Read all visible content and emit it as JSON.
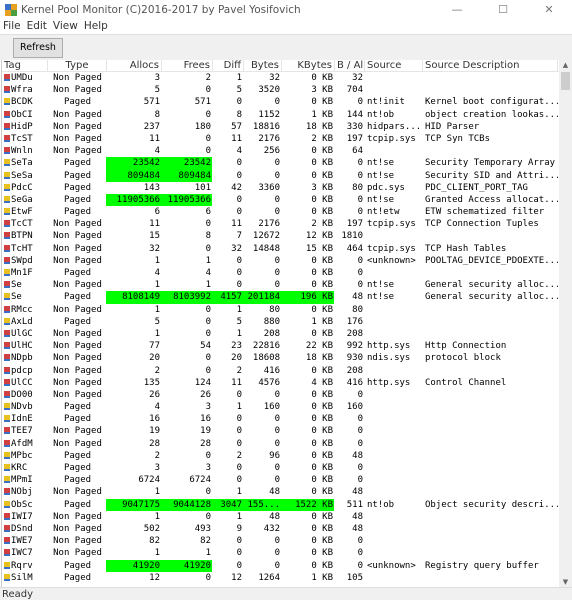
{
  "window": {
    "title": "Kernel Pool Monitor (C)2016-2017 by Pavel Yosifovich",
    "minimize": "—",
    "maximize": "☐",
    "close": "✕"
  },
  "menu": [
    "File",
    "Edit",
    "View",
    "Help"
  ],
  "toolbar": {
    "refresh_label": "Refresh"
  },
  "colors": {
    "highlight": "#00ff00",
    "paged_icon": "#e8c020",
    "nonpaged_icon": "#d04040"
  },
  "table": {
    "columns": [
      "Tag",
      "Type",
      "Allocs",
      "Frees",
      "Diff",
      "Bytes",
      "KBytes",
      "B / Al...",
      "Source",
      "Source Description"
    ],
    "rows": [
      [
        "UMDu",
        "Non Paged",
        "3",
        "2",
        "1",
        "32",
        "0 KB",
        "32",
        "",
        "",
        ""
      ],
      [
        "Wfra",
        "Non Paged",
        "5",
        "0",
        "5",
        "3520",
        "3 KB",
        "704",
        "",
        "",
        ""
      ],
      [
        "BCDK",
        "Paged",
        "571",
        "571",
        "0",
        "0",
        "0 KB",
        "0",
        "nt!init",
        "Kernel boot configurat...",
        ""
      ],
      [
        "ObCI",
        "Non Paged",
        "8",
        "0",
        "8",
        "1152",
        "1 KB",
        "144",
        "nt!ob",
        "object creation lookas...",
        ""
      ],
      [
        "HidP",
        "Non Paged",
        "237",
        "180",
        "57",
        "18816",
        "18 KB",
        "330",
        "hidpars...",
        "HID Parser",
        ""
      ],
      [
        "TcST",
        "Non Paged",
        "11",
        "0",
        "11",
        "2176",
        "2 KB",
        "197",
        "tcpip.sys",
        "TCP Syn TCBs",
        ""
      ],
      [
        "Wnln",
        "Non Paged",
        "4",
        "0",
        "4",
        "256",
        "0 KB",
        "64",
        "",
        "",
        ""
      ],
      [
        "SeTa",
        "Paged",
        "23542",
        "23542",
        "0",
        "0",
        "0 KB",
        "0",
        "nt!se",
        "Security Temporary Array",
        "af"
      ],
      [
        "SeSa",
        "Paged",
        "809484",
        "809484",
        "0",
        "0",
        "0 KB",
        "0",
        "nt!se",
        "Security SID and Attri...",
        "af"
      ],
      [
        "PdcC",
        "Paged",
        "143",
        "101",
        "42",
        "3360",
        "3 KB",
        "80",
        "pdc.sys",
        "PDC_CLIENT_PORT_TAG",
        ""
      ],
      [
        "SeGa",
        "Paged",
        "11905366",
        "11905366",
        "0",
        "0",
        "0 KB",
        "0",
        "nt!se",
        "Granted Access allocat...",
        "af"
      ],
      [
        "EtwF",
        "Paged",
        "6",
        "6",
        "0",
        "0",
        "0 KB",
        "0",
        "nt!etw",
        "ETW schematized filter",
        ""
      ],
      [
        "TcCT",
        "Non Paged",
        "11",
        "0",
        "11",
        "2176",
        "2 KB",
        "197",
        "tcpip.sys",
        "TCP Connection Tuples",
        ""
      ],
      [
        "BTPN",
        "Non Paged",
        "15",
        "8",
        "7",
        "12672",
        "12 KB",
        "1810",
        "",
        "",
        ""
      ],
      [
        "TcHT",
        "Non Paged",
        "32",
        "0",
        "32",
        "14848",
        "15 KB",
        "464",
        "tcpip.sys",
        "TCP Hash Tables",
        ""
      ],
      [
        "SWpd",
        "Non Paged",
        "1",
        "1",
        "0",
        "0",
        "0 KB",
        "0",
        "<unknown>",
        "POOLTAG_DEVICE_PDOEXTE...",
        ""
      ],
      [
        "Mn1F",
        "Paged",
        "4",
        "4",
        "0",
        "0",
        "0 KB",
        "0",
        "",
        "",
        ""
      ],
      [
        "Se",
        "Non Paged",
        "1",
        "1",
        "0",
        "0",
        "0 KB",
        "0",
        "nt!se",
        "General security alloc...",
        ""
      ],
      [
        "Se",
        "Paged",
        "8108149",
        "8103992",
        "4157",
        "201184",
        "196 KB",
        "48",
        "nt!se",
        "General security alloc...",
        "all"
      ],
      [
        "RMcc",
        "Non Paged",
        "1",
        "0",
        "1",
        "80",
        "0 KB",
        "80",
        "",
        "",
        ""
      ],
      [
        "AxLd",
        "Paged",
        "5",
        "0",
        "5",
        "880",
        "1 KB",
        "176",
        "",
        "",
        ""
      ],
      [
        "UlGC",
        "Non Paged",
        "1",
        "0",
        "1",
        "208",
        "0 KB",
        "208",
        "",
        "",
        ""
      ],
      [
        "UlHC",
        "Non Paged",
        "77",
        "54",
        "23",
        "22816",
        "22 KB",
        "992",
        "http.sys",
        "Http Connection",
        ""
      ],
      [
        "NDpb",
        "Non Paged",
        "20",
        "0",
        "20",
        "18608",
        "18 KB",
        "930",
        "ndis.sys",
        "protocol block",
        ""
      ],
      [
        "pdcp",
        "Non Paged",
        "2",
        "0",
        "2",
        "416",
        "0 KB",
        "208",
        "",
        "",
        ""
      ],
      [
        "UlCC",
        "Non Paged",
        "135",
        "124",
        "11",
        "4576",
        "4 KB",
        "416",
        "http.sys",
        "Control Channel",
        ""
      ],
      [
        "DO00",
        "Non Paged",
        "26",
        "26",
        "0",
        "0",
        "0 KB",
        "0",
        "",
        "",
        ""
      ],
      [
        "NDvb",
        "Paged",
        "4",
        "3",
        "1",
        "160",
        "0 KB",
        "160",
        "",
        "",
        ""
      ],
      [
        "IdnE",
        "Paged",
        "16",
        "16",
        "0",
        "0",
        "0 KB",
        "0",
        "",
        "",
        ""
      ],
      [
        "TEE7",
        "Non Paged",
        "19",
        "19",
        "0",
        "0",
        "0 KB",
        "0",
        "",
        "",
        ""
      ],
      [
        "AfdM",
        "Non Paged",
        "28",
        "28",
        "0",
        "0",
        "0 KB",
        "0",
        "",
        "",
        ""
      ],
      [
        "MPbc",
        "Paged",
        "2",
        "0",
        "2",
        "96",
        "0 KB",
        "48",
        "",
        "",
        ""
      ],
      [
        "KRC",
        "Paged",
        "3",
        "3",
        "0",
        "0",
        "0 KB",
        "0",
        "",
        "",
        ""
      ],
      [
        "MPmI",
        "Paged",
        "6724",
        "6724",
        "0",
        "0",
        "0 KB",
        "0",
        "",
        "",
        ""
      ],
      [
        "NObj",
        "Non Paged",
        "1",
        "0",
        "1",
        "48",
        "0 KB",
        "48",
        "",
        "",
        ""
      ],
      [
        "ObSc",
        "Paged",
        "9047175",
        "9044128",
        "3047",
        "155...",
        "1522 KB",
        "511",
        "nt!ob",
        "Object security descri...",
        "all"
      ],
      [
        "IWI7",
        "Non Paged",
        "1",
        "0",
        "1",
        "48",
        "0 KB",
        "48",
        "",
        "",
        ""
      ],
      [
        "DSnd",
        "Non Paged",
        "502",
        "493",
        "9",
        "432",
        "0 KB",
        "48",
        "",
        "",
        ""
      ],
      [
        "IWE7",
        "Non Paged",
        "82",
        "82",
        "0",
        "0",
        "0 KB",
        "0",
        "",
        "",
        ""
      ],
      [
        "IWC7",
        "Non Paged",
        "1",
        "1",
        "0",
        "0",
        "0 KB",
        "0",
        "",
        "",
        ""
      ],
      [
        "Rqrv",
        "Paged",
        "41920",
        "41920",
        "0",
        "0",
        "0 KB",
        "0",
        "<unknown>",
        "Registry query buffer",
        "af"
      ],
      [
        "SilM",
        "Paged",
        "12",
        "0",
        "12",
        "1264",
        "1 KB",
        "105",
        "",
        "",
        ""
      ]
    ]
  },
  "status": {
    "text": "Ready"
  }
}
